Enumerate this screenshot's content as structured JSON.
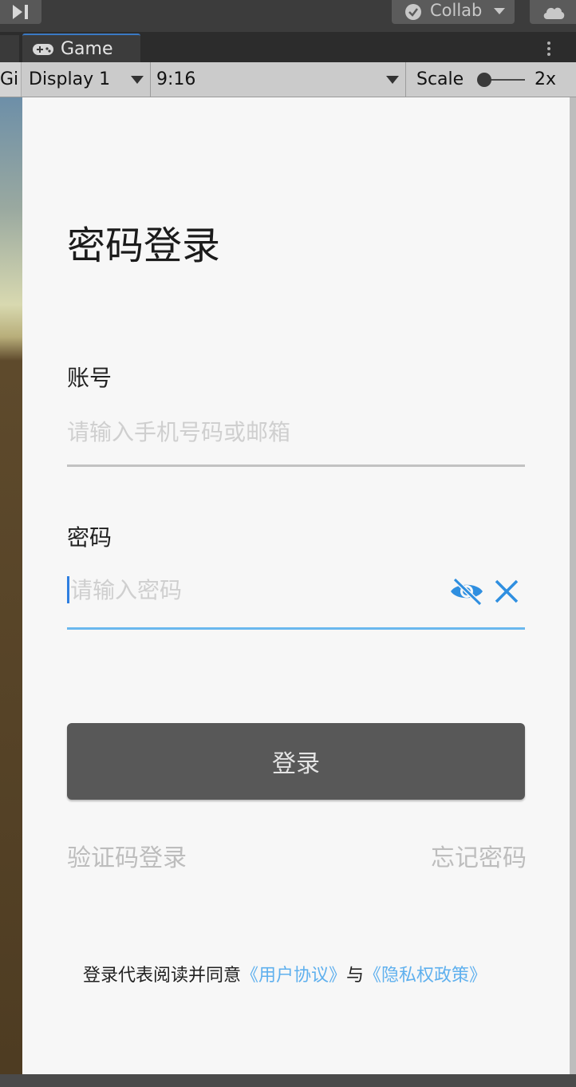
{
  "editor": {
    "collab_label": "Collab",
    "tab_game_label": "Game",
    "gizmos_stub": "Gi",
    "display_label": "Display 1",
    "aspect_label": "9:16",
    "scale_label": "Scale",
    "scale_value": "2x"
  },
  "login": {
    "title": "密码登录",
    "account_label": "账号",
    "account_placeholder": "请输入手机号码或邮箱",
    "password_label": "密码",
    "password_placeholder": "请输入密码",
    "login_button": "登录",
    "sms_login_link": "验证码登录",
    "forgot_password_link": "忘记密码",
    "agreement_prefix": "登录代表阅读并同意",
    "user_agreement_link": "《用户协议》",
    "agreement_and": "与",
    "privacy_policy_link": "《隐私权政策》"
  },
  "colors": {
    "accent": "#2f8fe0",
    "link": "#5fb0ee",
    "button_bg": "#585858"
  },
  "icons": {
    "password_visibility": "eye-off-icon",
    "clear": "close-icon"
  }
}
